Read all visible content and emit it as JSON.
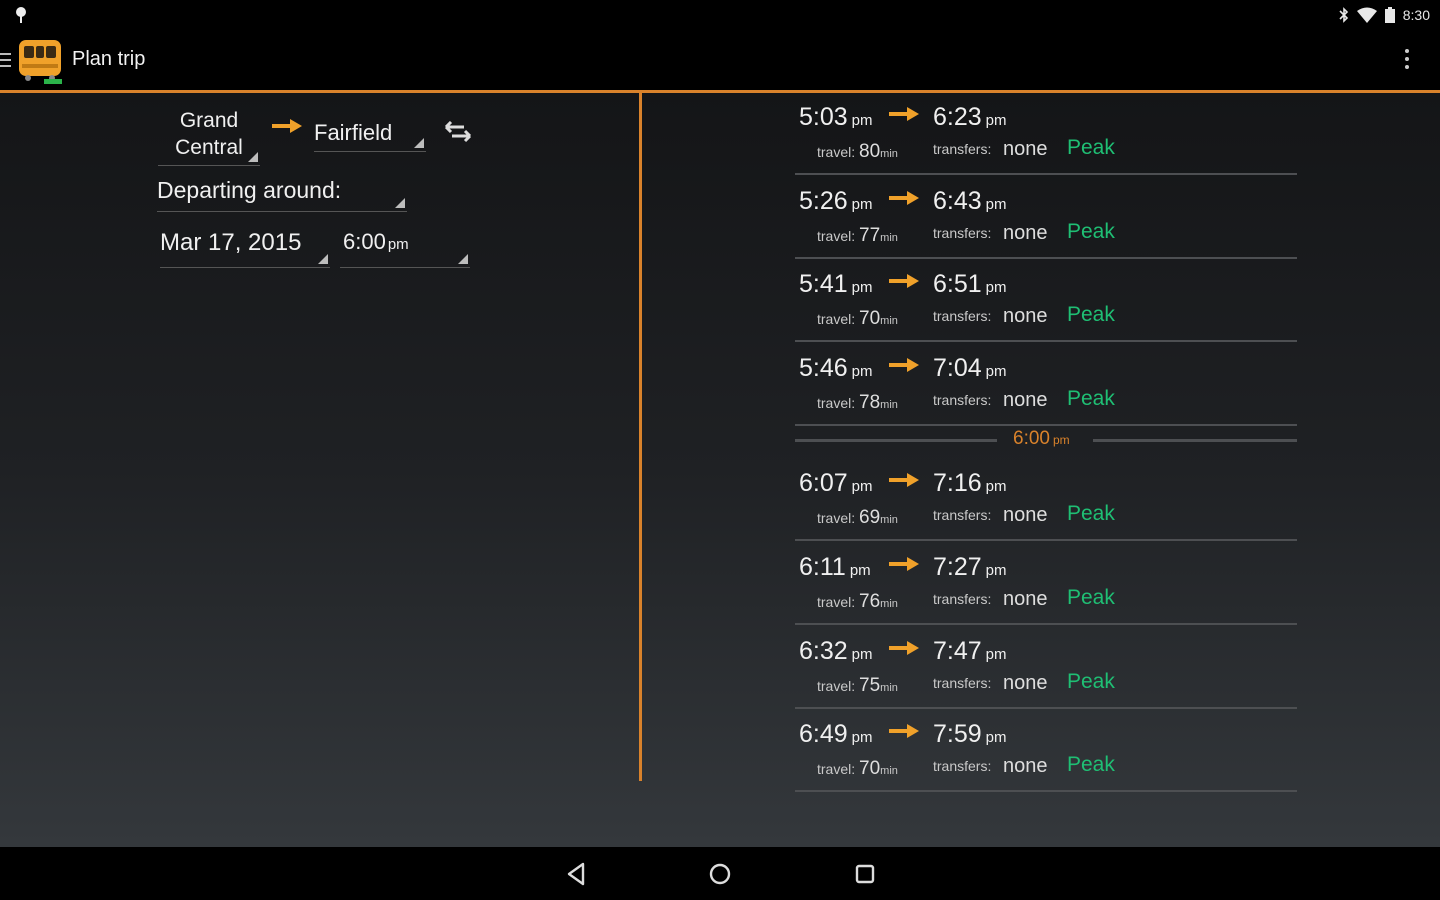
{
  "status_bar": {
    "time": "8:30"
  },
  "app": {
    "title": "Plan trip"
  },
  "colors": {
    "accent": "#d9822b",
    "peak": "#1fbf74"
  },
  "planner": {
    "from_line1": "Grand",
    "from_line2": "Central",
    "to": "Fairfield",
    "depart_label": "Departing around:",
    "date": "Mar 17, 2015",
    "time": "6:00",
    "time_ampm": "pm"
  },
  "trips_before": [
    {
      "depart": "5:03",
      "depart_ampm": "pm",
      "arrive": "6:23",
      "arrive_ampm": "pm",
      "travel_label": "travel:",
      "travel": "80",
      "travel_unit": "min",
      "transfers_label": "transfers:",
      "transfers": "none",
      "fare": "Peak"
    },
    {
      "depart": "5:26",
      "depart_ampm": "pm",
      "arrive": "6:43",
      "arrive_ampm": "pm",
      "travel_label": "travel:",
      "travel": "77",
      "travel_unit": "min",
      "transfers_label": "transfers:",
      "transfers": "none",
      "fare": "Peak"
    },
    {
      "depart": "5:41",
      "depart_ampm": "pm",
      "arrive": "6:51",
      "arrive_ampm": "pm",
      "travel_label": "travel:",
      "travel": "70",
      "travel_unit": "min",
      "transfers_label": "transfers:",
      "transfers": "none",
      "fare": "Peak"
    },
    {
      "depart": "5:46",
      "depart_ampm": "pm",
      "arrive": "7:04",
      "arrive_ampm": "pm",
      "travel_label": "travel:",
      "travel": "78",
      "travel_unit": "min",
      "transfers_label": "transfers:",
      "transfers": "none",
      "fare": "Peak"
    }
  ],
  "now_marker": {
    "time": "6:00",
    "ampm": "pm"
  },
  "trips_after": [
    {
      "depart": "6:07",
      "depart_ampm": "pm",
      "arrive": "7:16",
      "arrive_ampm": "pm",
      "travel_label": "travel:",
      "travel": "69",
      "travel_unit": "min",
      "transfers_label": "transfers:",
      "transfers": "none",
      "fare": "Peak"
    },
    {
      "depart": "6:11",
      "depart_ampm": "pm",
      "arrive": "7:27",
      "arrive_ampm": "pm",
      "travel_label": "travel:",
      "travel": "76",
      "travel_unit": "min",
      "transfers_label": "transfers:",
      "transfers": "none",
      "fare": "Peak"
    },
    {
      "depart": "6:32",
      "depart_ampm": "pm",
      "arrive": "7:47",
      "arrive_ampm": "pm",
      "travel_label": "travel:",
      "travel": "75",
      "travel_unit": "min",
      "transfers_label": "transfers:",
      "transfers": "none",
      "fare": "Peak"
    },
    {
      "depart": "6:49",
      "depart_ampm": "pm",
      "arrive": "7:59",
      "arrive_ampm": "pm",
      "travel_label": "travel:",
      "travel": "70",
      "travel_unit": "min",
      "transfers_label": "transfers:",
      "transfers": "none",
      "fare": "Peak"
    }
  ],
  "icons": {
    "status_left": "map-pin-icon",
    "status_right": [
      "bluetooth-icon",
      "wifi-icon",
      "battery-icon"
    ],
    "route_arrow": "right-arrow-icon",
    "swap": "swap-icon",
    "nav": [
      "back-icon",
      "home-icon",
      "recents-icon"
    ]
  }
}
